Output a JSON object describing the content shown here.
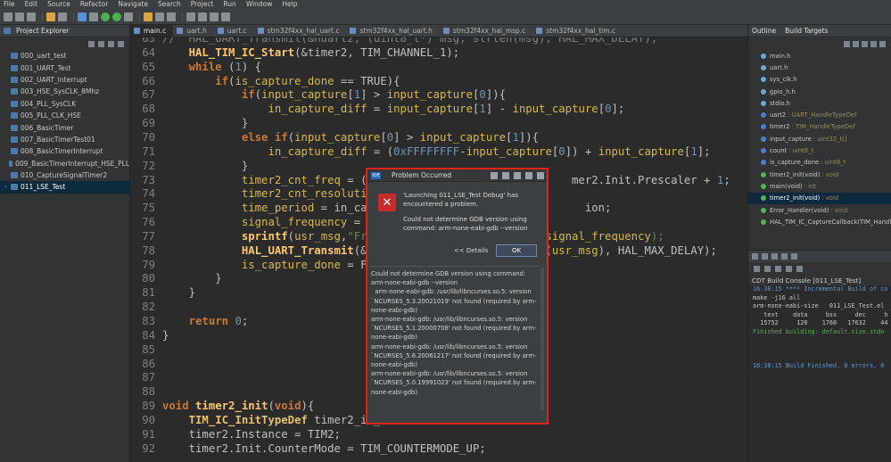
{
  "menubar": [
    "File",
    "Edit",
    "Source",
    "Refactor",
    "Navigate",
    "Search",
    "Project",
    "Run",
    "Window",
    "Help"
  ],
  "explorer": {
    "title": "Project Explorer",
    "items": [
      "000_uart_test",
      "001_UART_Test",
      "002_UART_Interrupt",
      "003_HSE_SysCLK_8Mhz",
      "004_PLL_SysCLK",
      "005_PLL_CLK_HSE",
      "006_BasicTimer",
      "007_BasicTimerTest01",
      "008_BasicTimerInterrupt",
      "009_BasicTimerInterrupt_HSE_PLL",
      "010_CaptureSignalTimer2",
      "011_LSE_Test"
    ],
    "selected_index": 11
  },
  "tabs": [
    "main.c",
    "uart.h",
    "uart.c",
    "stm32f4xx_hal_uart.c",
    "stm32f4xx_hal_uart.h",
    "stm32f4xx_hal_msp.c",
    "stm32f4xx_hal_tim.c"
  ],
  "code": [
    {
      "n": "63",
      "t": "//  HAL_UART_Transmit(&huart2, (uint8_t*) msg, strlen(msg), HAL_MAX_DELAY);"
    },
    {
      "n": "64",
      "t": "    HAL_TIM_IC_Start(&timer2, TIM_CHANNEL_1);"
    },
    {
      "n": "65",
      "t": "    while (1) {"
    },
    {
      "n": "66",
      "t": "        if(is_capture_done == TRUE){"
    },
    {
      "n": "67",
      "t": "            if(input_capture[1] > input_capture[0]){"
    },
    {
      "n": "68",
      "t": "                in_capture_diff = input_capture[1] - input_capture[0];"
    },
    {
      "n": "69",
      "t": "            }"
    },
    {
      "n": "70",
      "t": "            else if(input_capture[0] > input_capture[1]){"
    },
    {
      "n": "71",
      "t": "                in_capture_diff = (0xFFFFFFFF-input_capture[0]) + input_capture[1];"
    },
    {
      "n": "72",
      "t": "            }"
    },
    {
      "n": "73",
      "t": "            timer2_cnt_freq = (HA                             mer2.Init.Prescaler + 1;"
    },
    {
      "n": "74",
      "t": "            timer2_cnt_resolution"
    },
    {
      "n": "75",
      "t": "            time_period = in_capt                               ion;"
    },
    {
      "n": "76",
      "t": "            signal_frequency = 1/"
    },
    {
      "n": "77",
      "t": "            sprintf(usr_msg,\"Freq                         signal_frequency);"
    },
    {
      "n": "78",
      "t": "            HAL_UART_Transmit(&ua                        n(usr_msg), HAL_MAX_DELAY);"
    },
    {
      "n": "79",
      "t": "            is_capture_done = FAL"
    },
    {
      "n": "80",
      "t": "        }"
    },
    {
      "n": "81",
      "t": "    }"
    },
    {
      "n": "82",
      "t": ""
    },
    {
      "n": "83",
      "t": "    return 0;"
    },
    {
      "n": "84",
      "t": "}"
    },
    {
      "n": "85",
      "t": ""
    },
    {
      "n": "86",
      "t": ""
    },
    {
      "n": "87",
      "t": ""
    },
    {
      "n": "88",
      "t": ""
    },
    {
      "n": "89",
      "t": "void timer2_init(void){"
    },
    {
      "n": "90",
      "t": "    TIM_IC_InitTypeDef timer2_ic_"
    },
    {
      "n": "91",
      "t": "    timer2.Instance = TIM2;"
    },
    {
      "n": "92",
      "t": "    timer2.Init.CounterMode = TIM_COUNTERMODE_UP;"
    }
  ],
  "outline": {
    "tabs": [
      "Outline",
      "Build Targets"
    ],
    "items": [
      {
        "name": "main.h",
        "type": ""
      },
      {
        "name": "uart.h",
        "type": ""
      },
      {
        "name": "sys_clk.h",
        "type": ""
      },
      {
        "name": "gpio_h.h",
        "type": ""
      },
      {
        "name": "stdio.h",
        "type": ""
      },
      {
        "name": "uart2",
        "type": ": UART_HandleTypeDef"
      },
      {
        "name": "timer2",
        "type": ": TIM_HandleTypeDef"
      },
      {
        "name": "input_capture",
        "type": ": uint32_t[]"
      },
      {
        "name": "count",
        "type": ": uint8_t"
      },
      {
        "name": "is_capture_done",
        "type": ": uint8_t"
      },
      {
        "name": "timer2_init(void)",
        "type": ": void"
      },
      {
        "name": "main(void)",
        "type": ": int"
      },
      {
        "name": "timer2_init(void)",
        "type": ": void"
      },
      {
        "name": "Error_Handler(void)",
        "type": ": void"
      },
      {
        "name": "HAL_TIM_IC_CaptureCallback(TIM_Handle",
        "type": ""
      }
    ],
    "selected_index": 12
  },
  "console": {
    "title": "CDT Build Console [011_LSE_Test]",
    "lines": [
      "16:38:15 **** Incremental Build of co",
      "make -j16 all",
      "arm-none-eabi-size   011_LSE_Test.el",
      "   text    data     bss     dec     h",
      "  15752     120    1760   17632    44",
      "Finished building: default.size.stdo",
      "",
      "",
      "",
      "16:38:15 Build Finished. 0 errors, 0"
    ]
  },
  "dialog": {
    "title": "Problem Occurred",
    "message1": "'Launching 011_LSE_Test Debug' has encountered a problem.",
    "message2": "Could not determine GDB version using command: arm-none-eabi-gdb --version",
    "details_button": "<< Details",
    "ok_button": "OK",
    "details": "Could not determine GDB version using command: arm-none-eabi-gdb --version\n  arm-none-eabi-gdb: /usr/lib/libncurses.so.5: version `NCURSES_5.3.20021019' not found (required by arm-none-eabi-gdb)\narm-none-eabi-gdb: /usr/lib/libncurses.so.5: version `NCURSES_5.1.20000708' not found (required by arm-none-eabi-gdb)\narm-none-eabi-gdb: /usr/lib/libncurses.so.5: version `NCURSES_5.6.20061217' not found (required by arm-none-eabi-gdb)\narm-none-eabi-gdb: /usr/lib/libncurses.so.5: version `NCURSES_5.0.19991023' not found (required by arm-none-eabi-gdb)"
  }
}
